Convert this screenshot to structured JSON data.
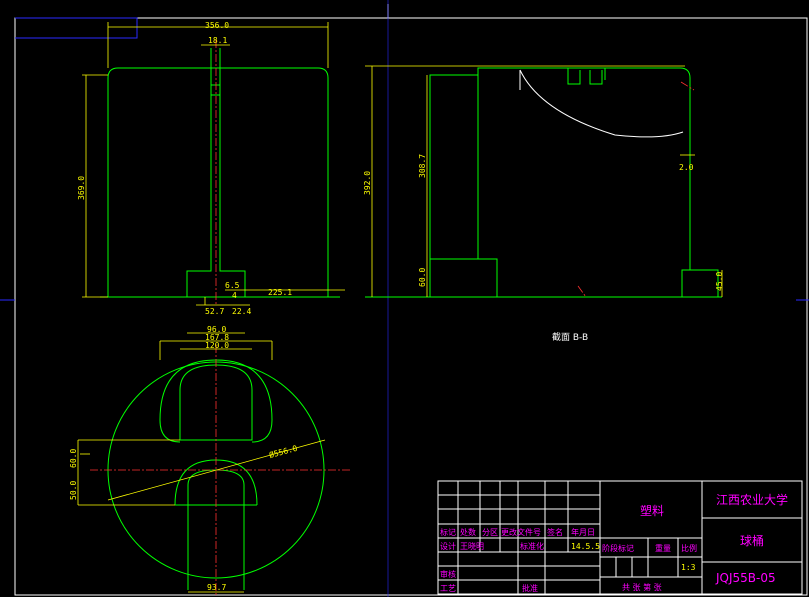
{
  "front_view": {
    "dim_width": "356.0",
    "dim_slot": "18.1",
    "dim_height": "369.0",
    "dim_small_a": "6.5",
    "dim_small_b": "4",
    "dim_base": "52.7",
    "dim_base_b": "22.4",
    "dim_offset": "225.1"
  },
  "section_view": {
    "dim_height": "392.0",
    "dim_inner": "308.7",
    "dim_step": "60.0",
    "dim_wall": "2.0",
    "dim_foot": "45.0",
    "label": "截面 B-B"
  },
  "top_view": {
    "dim_a": "96.0",
    "dim_b": "167.8",
    "dim_c": "120.0",
    "dim_diameter": "Ø556.0",
    "dim_left_a": "60.0",
    "dim_left_b": "50.0",
    "dim_bottom": "93.7"
  },
  "title_block": {
    "material": "塑料",
    "school": "江西农业大学",
    "part_name": "球桶",
    "drawing_no": "JQJ55B-05",
    "scale": "1:3",
    "date": "14.5.5",
    "designer": "王晓明",
    "hdr_mark": "标记",
    "hdr_count": "处数",
    "hdr_zone": "分区",
    "hdr_doc": "更改文件号",
    "hdr_sign": "签名",
    "hdr_date": "年月日",
    "lbl_design": "设计",
    "lbl_standard": "标准化",
    "lbl_stage": "阶段标记",
    "lbl_weight": "重量",
    "lbl_ratio": "比例",
    "lbl_review": "审核",
    "lbl_process": "工艺",
    "lbl_approve": "批准",
    "lbl_sheets": "共 张 第 张"
  }
}
